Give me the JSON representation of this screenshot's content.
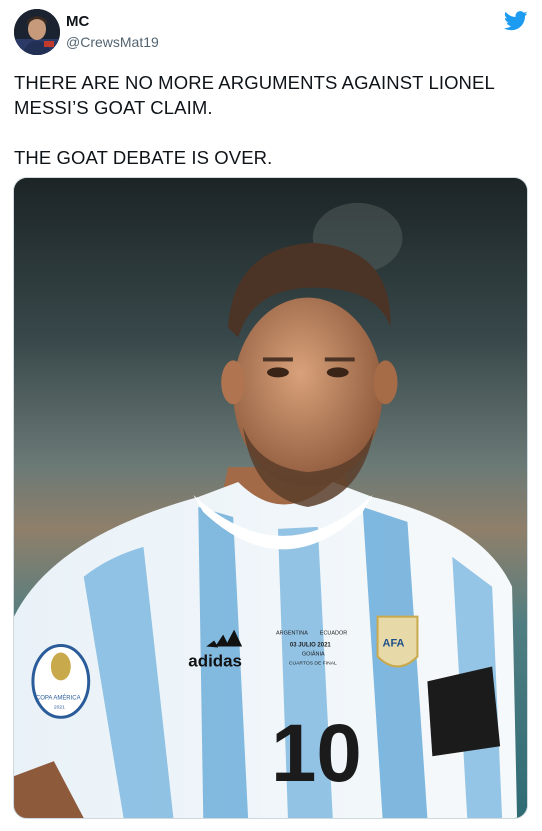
{
  "user": {
    "name": "MC",
    "handle": "@CrewsMat19",
    "avatar_icon": "profile-photo"
  },
  "brand": {
    "icon": "twitter-bird-icon",
    "color": "#1d9bf0"
  },
  "tweet": {
    "line1": "THERE ARE NO MORE ARGUMENTS AGAINST LIONEL",
    "line2": "MESSI’S GOAT CLAIM.",
    "line3": "THE GOAT DEBATE IS OVER."
  },
  "photo": {
    "description_icon": "player-photo",
    "shirt_brand": "adidas",
    "shirt_number": "10",
    "crest": "AFA",
    "match_patch": {
      "line1": "ARGENTINA",
      "line2": "ECUADOR",
      "line3": "03 JULIO 2021",
      "line4": "GOIÂNIA",
      "line5": "CUARTOS DE FINAL"
    },
    "sleeve_patch_1": "COPA AMÉRICA",
    "sleeve_patch_2": "2021"
  }
}
